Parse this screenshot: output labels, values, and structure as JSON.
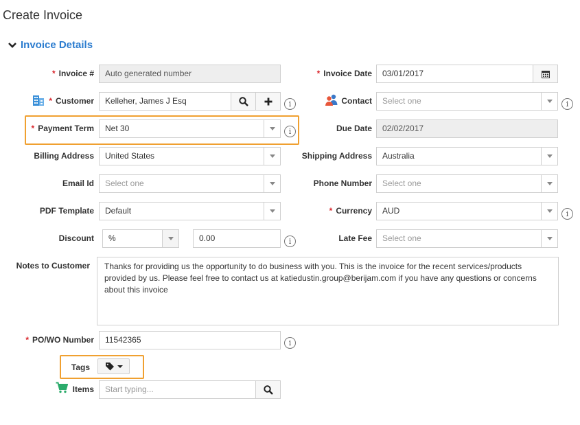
{
  "page": {
    "title": "Create Invoice"
  },
  "section": {
    "title": "Invoice Details"
  },
  "form": {
    "invoice_no": {
      "label": "Invoice #",
      "value": "Auto generated number"
    },
    "invoice_date": {
      "label": "Invoice Date",
      "value": "03/01/2017"
    },
    "customer": {
      "label": "Customer",
      "value": "Kelleher, James J Esq"
    },
    "contact": {
      "label": "Contact",
      "placeholder": "Select one"
    },
    "payment_term": {
      "label": "Payment Term",
      "value": "Net 30"
    },
    "due_date": {
      "label": "Due Date",
      "value": "02/02/2017"
    },
    "billing_address": {
      "label": "Billing Address",
      "value": "United States"
    },
    "shipping_address": {
      "label": "Shipping Address",
      "value": "Australia"
    },
    "email_id": {
      "label": "Email Id",
      "placeholder": "Select one"
    },
    "phone_number": {
      "label": "Phone Number",
      "placeholder": "Select one"
    },
    "pdf_template": {
      "label": "PDF Template",
      "value": "Default"
    },
    "currency": {
      "label": "Currency",
      "value": "AUD"
    },
    "discount": {
      "label": "Discount",
      "type": "%",
      "value": "0.00"
    },
    "late_fee": {
      "label": "Late Fee",
      "placeholder": "Select one"
    },
    "notes": {
      "label": "Notes to Customer",
      "value": "Thanks for providing us the opportunity to do business with you. This is the invoice for the recent services/products provided by us. Please feel free to contact us at katiedustin.group@berijam.com if you have any questions or concerns about this invoice"
    },
    "po_wo": {
      "label": "PO/WO Number",
      "value": "11542365"
    },
    "tags": {
      "label": "Tags"
    },
    "items": {
      "label": "Items",
      "placeholder": "Start typing..."
    }
  },
  "required_mark": "*",
  "info_glyph": "i",
  "colors": {
    "accent": "#2b7ccf",
    "required": "#d9262c",
    "highlight": "#f0a030",
    "cart": "#2bab6b"
  },
  "icons": [
    "chevron-down-icon",
    "building-icon",
    "search-icon",
    "plus-icon",
    "info-icon",
    "contacts-icon",
    "calendar-icon",
    "tag-icon",
    "cart-icon"
  ]
}
